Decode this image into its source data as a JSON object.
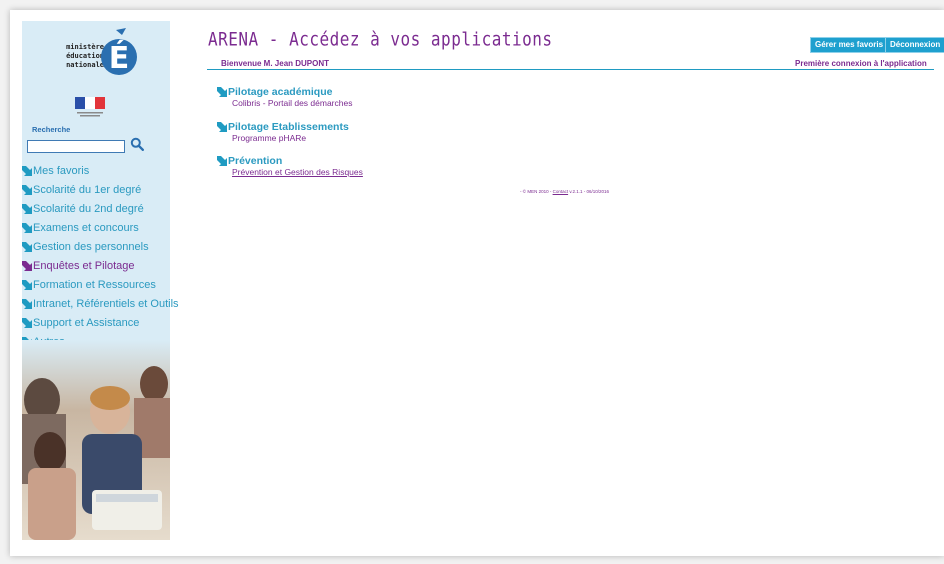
{
  "header": {
    "title": "ARENA - Accédez à vos applications",
    "welcome": "Bienvenue M. Jean DUPONT",
    "favorites_button": "Gérer mes favoris",
    "logout_button": "Déconnexion",
    "first_connection": "Première connexion à l'application"
  },
  "logo": {
    "line1": "ministère",
    "line2": "éducation",
    "line3": "nationale",
    "letter": "É"
  },
  "search": {
    "label": "Recherche",
    "value": ""
  },
  "menu": {
    "items": [
      {
        "label": "Mes favoris"
      },
      {
        "label": "Scolarité du 1er degré"
      },
      {
        "label": "Scolarité du 2nd degré"
      },
      {
        "label": "Examens et concours"
      },
      {
        "label": "Gestion des personnels"
      },
      {
        "label": "Enquêtes et Pilotage"
      },
      {
        "label": "Formation et Ressources"
      },
      {
        "label": "Intranet, Référentiels et Outils"
      },
      {
        "label": "Support et Assistance"
      },
      {
        "label": "Autres"
      }
    ],
    "active_index": 5
  },
  "sections": [
    {
      "title": "Pilotage académique",
      "link": "Colibris - Portail des démarches"
    },
    {
      "title": "Pilotage Etablissements",
      "link": "Programme pHARe"
    },
    {
      "title": "Prévention",
      "link": "Prévention et Gestion des Risques"
    }
  ],
  "footer": {
    "prefix": "- © MEN 2010 - ",
    "contact": "Contact",
    "suffix": " v.2.1.1 - 06/10/2016"
  },
  "colors": {
    "accent_purple": "#7b2b90",
    "accent_blue": "#2b9ac0",
    "button_blue": "#1ea0cf",
    "sidebar_bg": "#d9ecf6"
  }
}
